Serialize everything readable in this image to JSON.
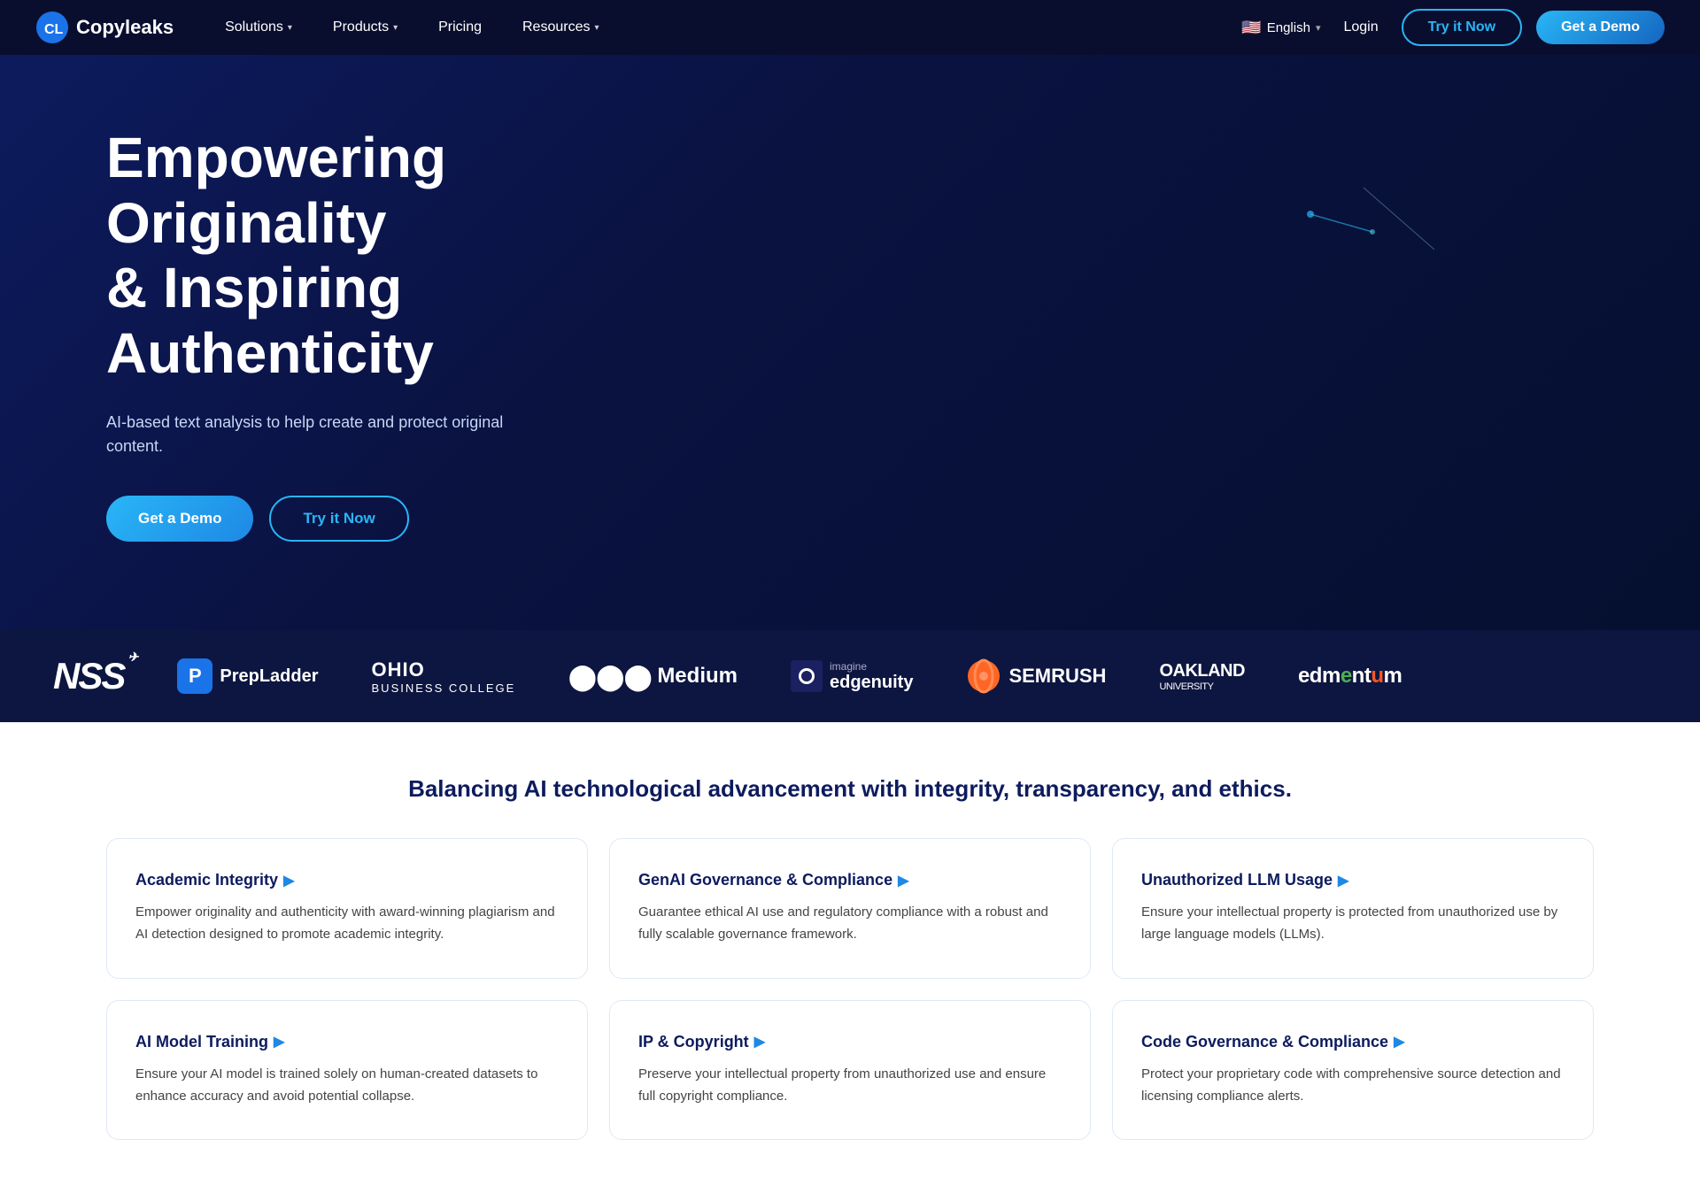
{
  "nav": {
    "logo_text": "Copyleaks",
    "links": [
      {
        "label": "Solutions",
        "has_dropdown": true
      },
      {
        "label": "Products",
        "has_dropdown": true
      },
      {
        "label": "Pricing",
        "has_dropdown": false
      },
      {
        "label": "Resources",
        "has_dropdown": true
      }
    ],
    "language": "English",
    "login_label": "Login",
    "try_now_label": "Try it Now",
    "get_demo_label": "Get a Demo"
  },
  "hero": {
    "title_line1": "Empowering Originality",
    "title_line2": "& Inspiring Authenticity",
    "subtitle": "AI-based text analysis to help create and protect original content.",
    "btn_demo": "Get a Demo",
    "btn_try": "Try it Now"
  },
  "logos": [
    {
      "name": "NSS",
      "type": "nss"
    },
    {
      "name": "PrepLadder",
      "type": "prepladder"
    },
    {
      "name": "OHIO BUSINESS COLLEGE",
      "type": "ohio"
    },
    {
      "name": "Medium",
      "type": "medium"
    },
    {
      "name": "imagine edgenuity",
      "type": "edgenuity"
    },
    {
      "name": "SEMRUSH",
      "type": "semrush"
    },
    {
      "name": "OAKLAND UNIVERSITY",
      "type": "oakland"
    },
    {
      "name": "edmentum",
      "type": "edmentum"
    }
  ],
  "features": {
    "heading": "Balancing AI technological advancement with integrity, transparency, and ethics.",
    "cards": [
      {
        "title": "Academic Integrity",
        "description": "Empower originality and authenticity with award-winning plagiarism and AI detection designed to promote academic integrity."
      },
      {
        "title": "GenAI Governance & Compliance",
        "description": "Guarantee ethical AI use and regulatory compliance with a robust and fully scalable governance framework."
      },
      {
        "title": "Unauthorized LLM Usage",
        "description": "Ensure your intellectual property is protected from unauthorized use by large language models (LLMs)."
      },
      {
        "title": "AI Model Training",
        "description": "Ensure your AI model is trained solely on human-created datasets to enhance accuracy and avoid potential collapse."
      },
      {
        "title": "IP & Copyright",
        "description": "Preserve your intellectual property from unauthorized use and ensure full copyright compliance."
      },
      {
        "title": "Code Governance & Compliance",
        "description": "Protect your proprietary code with comprehensive source detection and licensing compliance alerts."
      }
    ]
  }
}
